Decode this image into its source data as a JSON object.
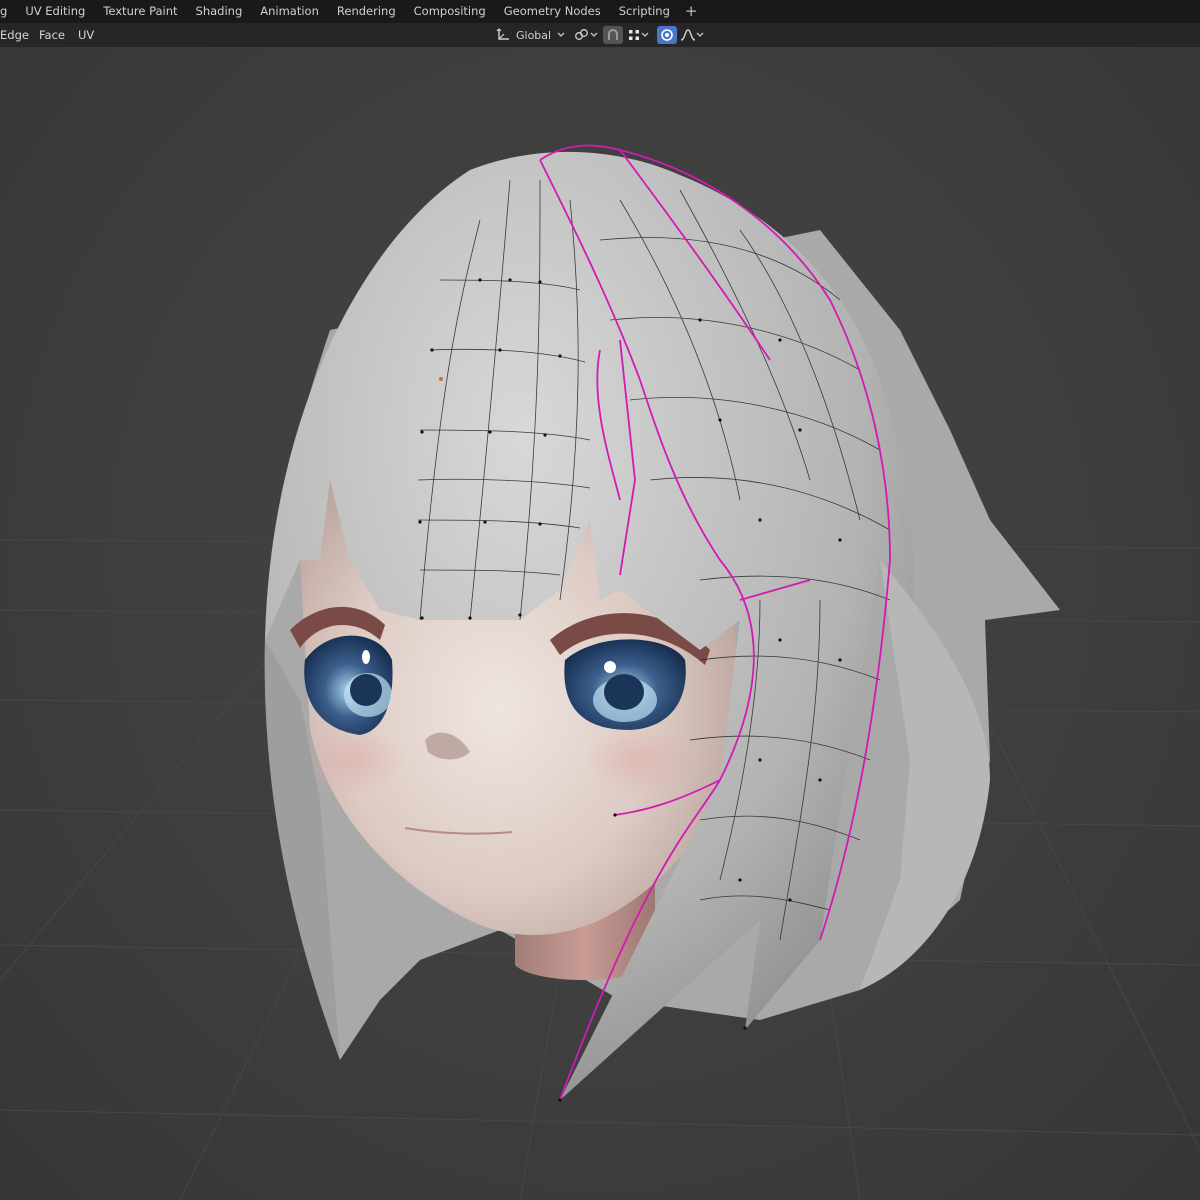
{
  "workspace_tabs": [
    {
      "label": "g"
    },
    {
      "label": "UV Editing"
    },
    {
      "label": "Texture Paint"
    },
    {
      "label": "Shading"
    },
    {
      "label": "Animation"
    },
    {
      "label": "Rendering"
    },
    {
      "label": "Compositing"
    },
    {
      "label": "Geometry Nodes"
    },
    {
      "label": "Scripting"
    }
  ],
  "add_workspace_label": "+",
  "header_menu": {
    "edge": "Edge",
    "face": "Face",
    "uv": "UV"
  },
  "transform_orientation": {
    "value": "Global",
    "icon": "transform-axes-icon"
  },
  "icons": {
    "pivot": "pivot-link-icon",
    "snap": "snap-magnet-icon",
    "snap_target": "snap-grid-icon",
    "proportional": "proportional-edit-icon",
    "falloff": "falloff-curve-icon"
  },
  "colors": {
    "topbar_bg": "#191919",
    "header_bg": "#262626",
    "viewport_bg": "#3d3d3d",
    "seam_color": "#d21ab4",
    "proportional_active": "#4a76c9",
    "hair_color": "#bdbdbd",
    "skin_color": "#e8d9d2"
  }
}
